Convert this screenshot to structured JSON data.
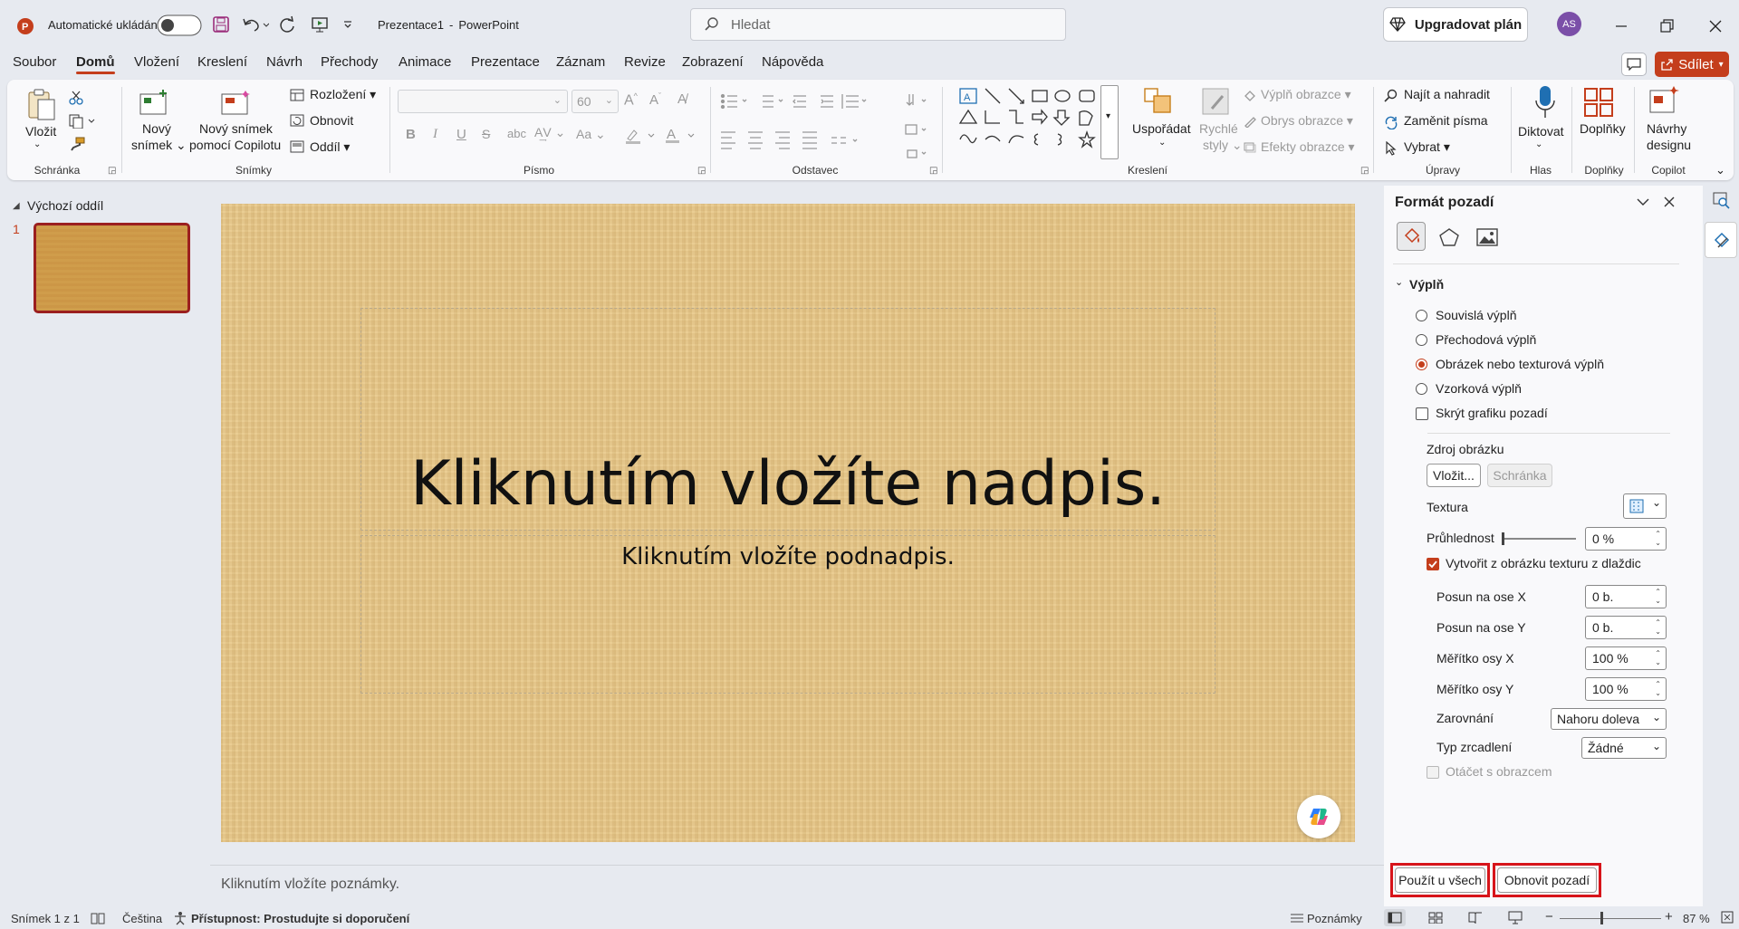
{
  "titlebar": {
    "autosave_label": "Automatické ukládání",
    "doc_title": "Prezentace1",
    "separator": "-",
    "app_name": "PowerPoint",
    "search_placeholder": "Hledat",
    "upgrade_label": "Upgradovat plán",
    "avatar_initials": "AS",
    "accent_color": "#c43e1c"
  },
  "tabs": [
    "Soubor",
    "Domů",
    "Vložení",
    "Kreslení",
    "Návrh",
    "Přechody",
    "Animace",
    "Prezentace",
    "Záznam",
    "Revize",
    "Zobrazení",
    "Nápověda"
  ],
  "share_label": "Sdílet",
  "ribbon": {
    "paste": "Vložit",
    "groups": {
      "clipboard": "Schránka",
      "slides": "Snímky",
      "font": "Písmo",
      "paragraph": "Odstavec",
      "drawing": "Kreslení",
      "editing": "Úpravy",
      "voice": "Hlas",
      "addins": "Doplňky",
      "copilot": "Copilot"
    },
    "new_slide_1": "Nový",
    "new_slide_2": "snímek",
    "copilot_slide_1": "Nový snímek",
    "copilot_slide_2": "pomocí Copilotu",
    "layout": "Rozložení",
    "reset": "Obnovit",
    "section": "Oddíl",
    "font_size": "60",
    "arrange": "Uspořádat",
    "quick_styles_1": "Rychlé",
    "quick_styles_2": "styly",
    "shape_fill": "Výplň obrazce",
    "shape_outline": "Obrys obrazce",
    "shape_effects": "Efekty obrazce",
    "find_replace": "Najít a nahradit",
    "replace_fonts": "Zaměnit písma",
    "select": "Vybrat",
    "dictate": "Diktovat",
    "addins": "Doplňky",
    "designer_1": "Návrhy",
    "designer_2": "designu"
  },
  "slides_panel": {
    "section_name": "Výchozí oddíl",
    "slide_number": "1"
  },
  "slide": {
    "title": "Kliknutím vložíte nadpis.",
    "subtitle": "Kliknutím vložíte podnadpis."
  },
  "notes_placeholder": "Kliknutím vložíte poznámky.",
  "format_pane": {
    "title": "Formát pozadí",
    "section": "Výplň",
    "options": [
      "Souvislá výplň",
      "Přechodová výplň",
      "Obrázek nebo texturová výplň",
      "Vzorková výplň"
    ],
    "selected_option": "Obrázek nebo texturová výplň",
    "hide_graphics": "Skrýt grafiku pozadí",
    "picture_source": "Zdroj obrázku",
    "insert_button": "Vložit...",
    "clipboard_button": "Schránka",
    "texture_label": "Textura",
    "transparency_label": "Průhlednost",
    "transparency_value": "0 %",
    "tile_label": "Vytvořit z obrázku texturu z dlaždic",
    "offset_x_label": "Posun na ose X",
    "offset_x_value": "0 b.",
    "offset_y_label": "Posun na ose Y",
    "offset_y_value": "0 b.",
    "scale_x_label": "Měřítko osy X",
    "scale_x_value": "100 %",
    "scale_y_label": "Měřítko osy Y",
    "scale_y_value": "100 %",
    "alignment_label": "Zarovnání",
    "alignment_value": "Nahoru doleva",
    "mirror_label": "Typ zrcadlení",
    "mirror_value": "Žádné",
    "rotate_label": "Otáčet s obrazcem",
    "apply_all": "Použít u všech",
    "reset_background": "Obnovit pozadí"
  },
  "status": {
    "slide_info": "Snímek 1 z 1",
    "language": "Čeština",
    "accessibility": "Přístupnost: Prostudujte si doporučení",
    "notes": "Poznámky",
    "zoom": "87 %"
  }
}
